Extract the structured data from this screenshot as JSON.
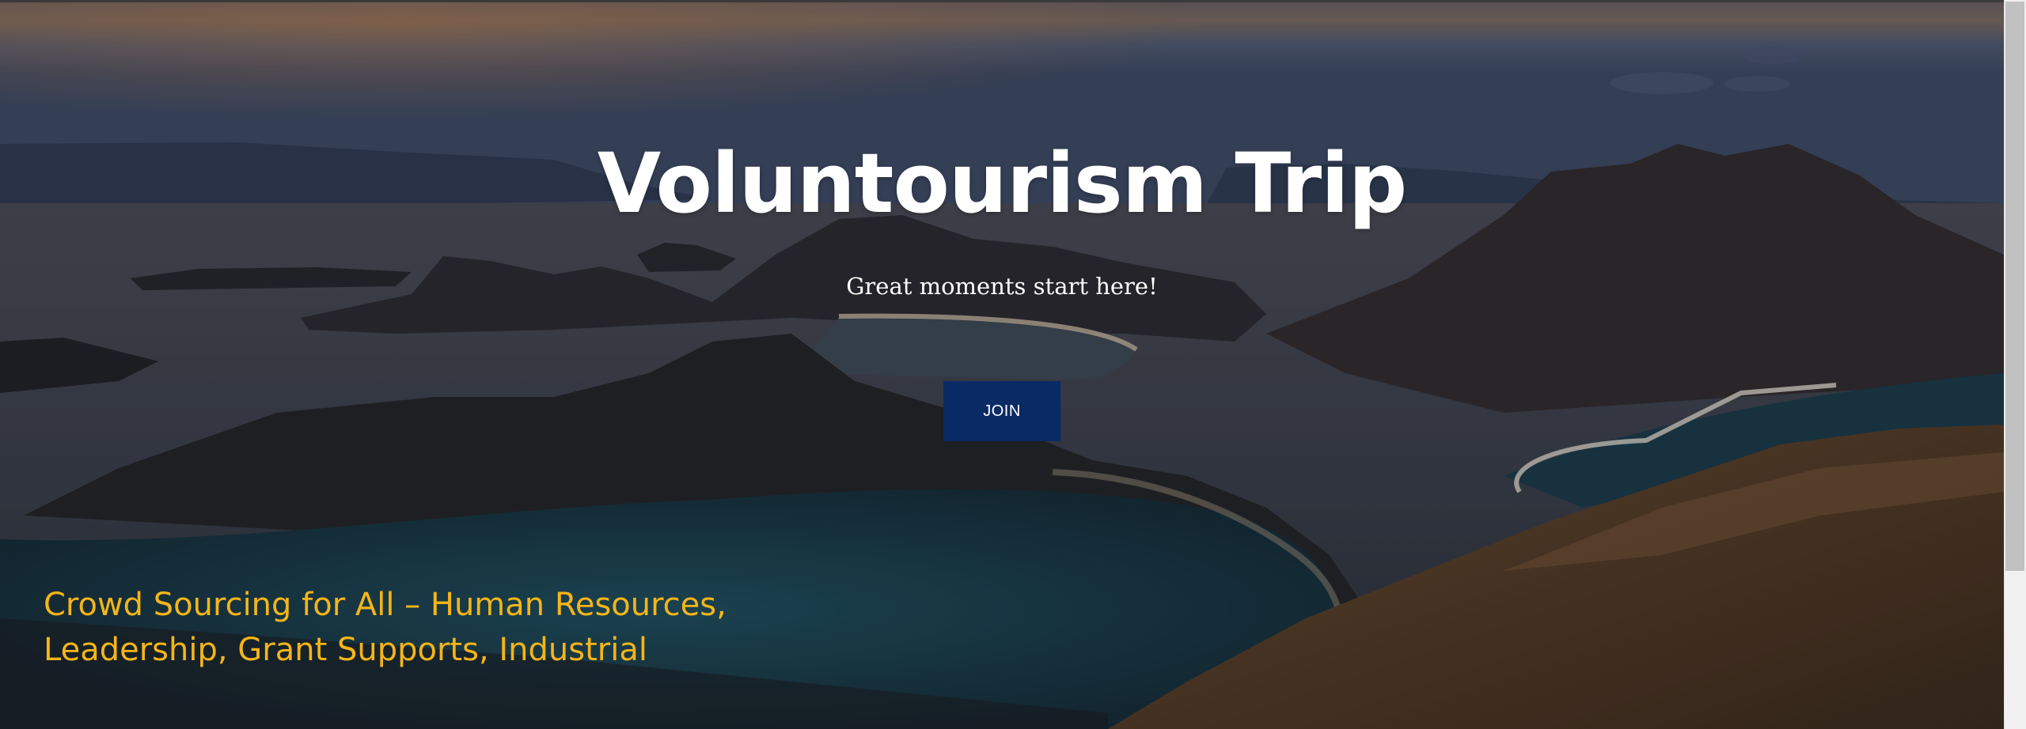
{
  "hero": {
    "title": "Voluntourism Trip",
    "tagline": "Great moments start here!",
    "join_label": "JOIN",
    "promo_line1": "Crowd Sourcing for All – Human Resources,",
    "promo_line2": "Leadership, Grant Supports, Industrial"
  },
  "colors": {
    "button_bg": "#0a2a66",
    "promo_text": "#f4b518",
    "title_text": "#ffffff"
  }
}
